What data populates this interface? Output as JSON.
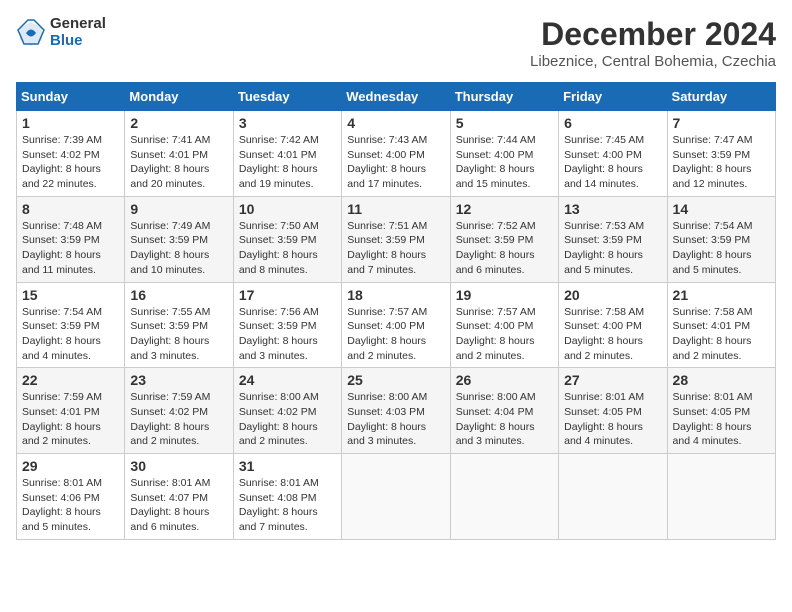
{
  "logo": {
    "general": "General",
    "blue": "Blue"
  },
  "title": "December 2024",
  "location": "Libeznice, Central Bohemia, Czechia",
  "weekdays": [
    "Sunday",
    "Monday",
    "Tuesday",
    "Wednesday",
    "Thursday",
    "Friday",
    "Saturday"
  ],
  "weeks": [
    [
      {
        "day": "1",
        "sunrise": "7:39 AM",
        "sunset": "4:02 PM",
        "daylight": "8 hours and 22 minutes."
      },
      {
        "day": "2",
        "sunrise": "7:41 AM",
        "sunset": "4:01 PM",
        "daylight": "8 hours and 20 minutes."
      },
      {
        "day": "3",
        "sunrise": "7:42 AM",
        "sunset": "4:01 PM",
        "daylight": "8 hours and 19 minutes."
      },
      {
        "day": "4",
        "sunrise": "7:43 AM",
        "sunset": "4:00 PM",
        "daylight": "8 hours and 17 minutes."
      },
      {
        "day": "5",
        "sunrise": "7:44 AM",
        "sunset": "4:00 PM",
        "daylight": "8 hours and 15 minutes."
      },
      {
        "day": "6",
        "sunrise": "7:45 AM",
        "sunset": "4:00 PM",
        "daylight": "8 hours and 14 minutes."
      },
      {
        "day": "7",
        "sunrise": "7:47 AM",
        "sunset": "3:59 PM",
        "daylight": "8 hours and 12 minutes."
      }
    ],
    [
      {
        "day": "8",
        "sunrise": "7:48 AM",
        "sunset": "3:59 PM",
        "daylight": "8 hours and 11 minutes."
      },
      {
        "day": "9",
        "sunrise": "7:49 AM",
        "sunset": "3:59 PM",
        "daylight": "8 hours and 10 minutes."
      },
      {
        "day": "10",
        "sunrise": "7:50 AM",
        "sunset": "3:59 PM",
        "daylight": "8 hours and 8 minutes."
      },
      {
        "day": "11",
        "sunrise": "7:51 AM",
        "sunset": "3:59 PM",
        "daylight": "8 hours and 7 minutes."
      },
      {
        "day": "12",
        "sunrise": "7:52 AM",
        "sunset": "3:59 PM",
        "daylight": "8 hours and 6 minutes."
      },
      {
        "day": "13",
        "sunrise": "7:53 AM",
        "sunset": "3:59 PM",
        "daylight": "8 hours and 5 minutes."
      },
      {
        "day": "14",
        "sunrise": "7:54 AM",
        "sunset": "3:59 PM",
        "daylight": "8 hours and 5 minutes."
      }
    ],
    [
      {
        "day": "15",
        "sunrise": "7:54 AM",
        "sunset": "3:59 PM",
        "daylight": "8 hours and 4 minutes."
      },
      {
        "day": "16",
        "sunrise": "7:55 AM",
        "sunset": "3:59 PM",
        "daylight": "8 hours and 3 minutes."
      },
      {
        "day": "17",
        "sunrise": "7:56 AM",
        "sunset": "3:59 PM",
        "daylight": "8 hours and 3 minutes."
      },
      {
        "day": "18",
        "sunrise": "7:57 AM",
        "sunset": "4:00 PM",
        "daylight": "8 hours and 2 minutes."
      },
      {
        "day": "19",
        "sunrise": "7:57 AM",
        "sunset": "4:00 PM",
        "daylight": "8 hours and 2 minutes."
      },
      {
        "day": "20",
        "sunrise": "7:58 AM",
        "sunset": "4:00 PM",
        "daylight": "8 hours and 2 minutes."
      },
      {
        "day": "21",
        "sunrise": "7:58 AM",
        "sunset": "4:01 PM",
        "daylight": "8 hours and 2 minutes."
      }
    ],
    [
      {
        "day": "22",
        "sunrise": "7:59 AM",
        "sunset": "4:01 PM",
        "daylight": "8 hours and 2 minutes."
      },
      {
        "day": "23",
        "sunrise": "7:59 AM",
        "sunset": "4:02 PM",
        "daylight": "8 hours and 2 minutes."
      },
      {
        "day": "24",
        "sunrise": "8:00 AM",
        "sunset": "4:02 PM",
        "daylight": "8 hours and 2 minutes."
      },
      {
        "day": "25",
        "sunrise": "8:00 AM",
        "sunset": "4:03 PM",
        "daylight": "8 hours and 3 minutes."
      },
      {
        "day": "26",
        "sunrise": "8:00 AM",
        "sunset": "4:04 PM",
        "daylight": "8 hours and 3 minutes."
      },
      {
        "day": "27",
        "sunrise": "8:01 AM",
        "sunset": "4:05 PM",
        "daylight": "8 hours and 4 minutes."
      },
      {
        "day": "28",
        "sunrise": "8:01 AM",
        "sunset": "4:05 PM",
        "daylight": "8 hours and 4 minutes."
      }
    ],
    [
      {
        "day": "29",
        "sunrise": "8:01 AM",
        "sunset": "4:06 PM",
        "daylight": "8 hours and 5 minutes."
      },
      {
        "day": "30",
        "sunrise": "8:01 AM",
        "sunset": "4:07 PM",
        "daylight": "8 hours and 6 minutes."
      },
      {
        "day": "31",
        "sunrise": "8:01 AM",
        "sunset": "4:08 PM",
        "daylight": "8 hours and 7 minutes."
      },
      null,
      null,
      null,
      null
    ]
  ]
}
